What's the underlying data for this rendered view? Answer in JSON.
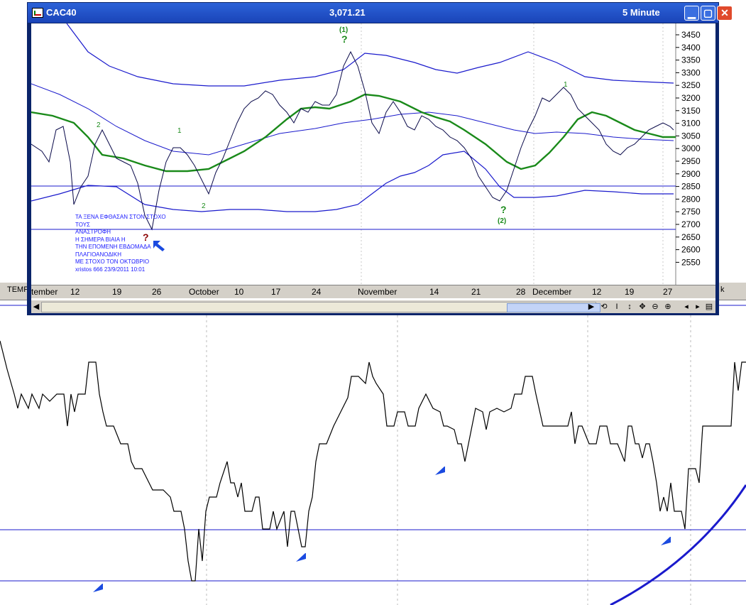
{
  "window": {
    "title": "CAC40",
    "last_price": "3,071.21",
    "interval": "5 Minute",
    "minimize": "▁",
    "maximize": "▢",
    "close": "✕"
  },
  "chart": {
    "y_ticks": [
      "3450",
      "3400",
      "3350",
      "3300",
      "3250",
      "3200",
      "3150",
      "3100",
      "3050",
      "3000",
      "2950",
      "2900",
      "2850",
      "2800",
      "2750",
      "2700",
      "2650",
      "2600",
      "2550"
    ],
    "x_ticks": [
      "tember",
      "12",
      "19",
      "26",
      "October",
      "10",
      "17",
      "24",
      "November",
      "14",
      "21",
      "28",
      "December",
      "12",
      "19",
      "27"
    ],
    "wave_labels": {
      "w1_top": "(1)",
      "w2_bottom": "(2)",
      "q": "?",
      "small_1a": "1",
      "small_2a": "2",
      "small_1b": "1",
      "small_2b": "2",
      "small_1c": "1"
    },
    "note_lines": [
      "ΤΑ ΞΕΝΑ ΕΦΘΑΣΑΝ ΣΤΟΝ ΣΤΟΧΟ",
      "ΤΟΥΣ",
      "ΑΝΑΣΤΡΟΦΗ",
      "Η ΣΗΜΕΡΑ ΒΙΑΙΑ Η",
      "ΤΗΝ ΕΠΟΜΕΝΗ ΕΒΔΟΜΑΔΑ",
      "ΠΛΑΓΙΟΑΝΟΔΙΚΗ",
      "ΜΕ ΣΤΟΧΟ ΤΟΝ ΟΚΤΩΒΡΙΟ",
      "xristos 666   23/9/2011 10:01"
    ]
  },
  "background": {
    "left_label": "TEMP",
    "right_label": "k"
  },
  "colors": {
    "ma": "#1a8a1a",
    "bands": "#1a1acc",
    "arrows": "#1a4ae0",
    "wave_label": "#1a8a1a",
    "question_red": "#8b0000"
  }
}
